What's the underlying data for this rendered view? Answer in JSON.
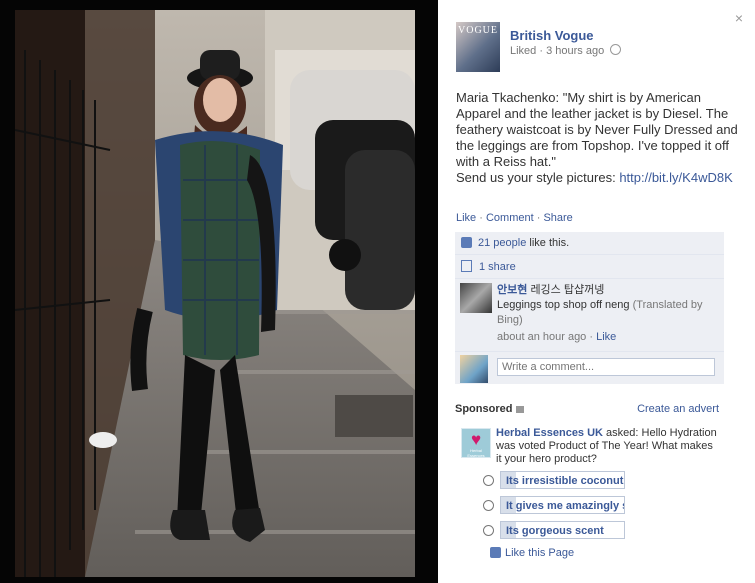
{
  "page": {
    "name": "British Vogue",
    "liked_label": "Liked",
    "time": "3 hours ago",
    "avatar_masthead": "VOGUE"
  },
  "post": {
    "caption": "Maria Tkachenko: \"My shirt is by American Apparel and the leather jacket is by Diesel. The feathery waistcoat is by Never Fully Dressed and the leggings are from Topshop. I've topped it off with a Reiss hat.\"",
    "cta": "Send us your style pictures: ",
    "url": "http://bit.ly/K4wD8K"
  },
  "actions": {
    "like": "Like",
    "comment": "Comment",
    "share": "Share",
    "sep": " · "
  },
  "ufi": {
    "likes_count": "21 people",
    "likes_suffix": " like this.",
    "shares": "1 share"
  },
  "comment": {
    "author": "안보현",
    "original": "레깅스 탑샵꺼넹",
    "translation": "Leggings top shop off neng",
    "translated_by": "(Translated by Bing)",
    "time": "about an hour ago",
    "like": "Like"
  },
  "composer": {
    "placeholder": "Write a comment..."
  },
  "sponsored": {
    "label": "Sponsored",
    "create_ad": "Create an advert",
    "advertiser": "Herbal Essences UK",
    "asked": " asked: Hello Hydration was voted Product of The Year! What makes it your hero product?",
    "logo_text": "Herbal Essences",
    "options": [
      {
        "label": "Its irresistible coconut",
        "fill": 0.12
      },
      {
        "label": "It gives me amazingly s",
        "fill": 0.12
      },
      {
        "label": "Its gorgeous scent",
        "fill": 0.12
      }
    ],
    "like_page": "Like this Page"
  },
  "colors": {
    "link": "#3b5998",
    "panel_bg": "#ffffff",
    "ufi_bg": "#edeff4",
    "stage_bg": "#070707"
  }
}
